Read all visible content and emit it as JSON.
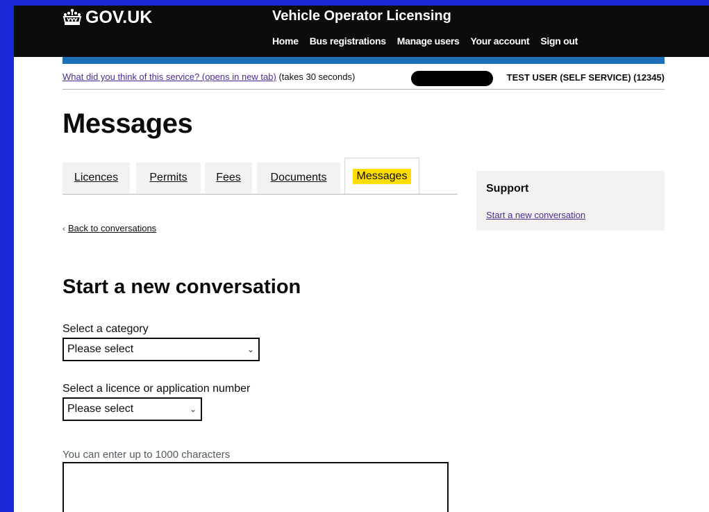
{
  "header": {
    "logo_text": "GOV.UK",
    "service_name": "Vehicle Operator Licensing",
    "nav": [
      "Home",
      "Bus registrations",
      "Manage users",
      "Your account",
      "Sign out"
    ]
  },
  "phase": {
    "feedback_link": "What did you think of this service? (opens in new tab)",
    "feedback_suffix": "(takes 30 seconds)",
    "user_label": "TEST USER (SELF SERVICE) (12345)"
  },
  "page_title": "Messages",
  "tabs": [
    {
      "label": "Licences",
      "active": false
    },
    {
      "label": "Permits",
      "active": false
    },
    {
      "label": "Fees",
      "active": false
    },
    {
      "label": "Documents",
      "active": false
    },
    {
      "label": "Messages",
      "active": true
    }
  ],
  "support": {
    "title": "Support",
    "link": "Start a new conversation"
  },
  "back_link": "Back to conversations",
  "form": {
    "heading": "Start a new conversation",
    "category_label": "Select a category",
    "category_value": "Please select",
    "licence_label": "Select a licence or application number",
    "licence_value": "Please select",
    "message_hint": "You can enter up to 1000 characters"
  },
  "colors": {
    "header_bg": "#0b0c0c",
    "accent_bar": "#1d70b8",
    "link_visited": "#4c2c92",
    "highlight": "#ffdd00",
    "panel_bg": "#f3f2f1",
    "frame_bg": "#1a28d8"
  },
  "icons": {
    "crown": "crown-icon",
    "back": "chevron-left-icon",
    "select_arrow": "chevron-down-icon"
  }
}
